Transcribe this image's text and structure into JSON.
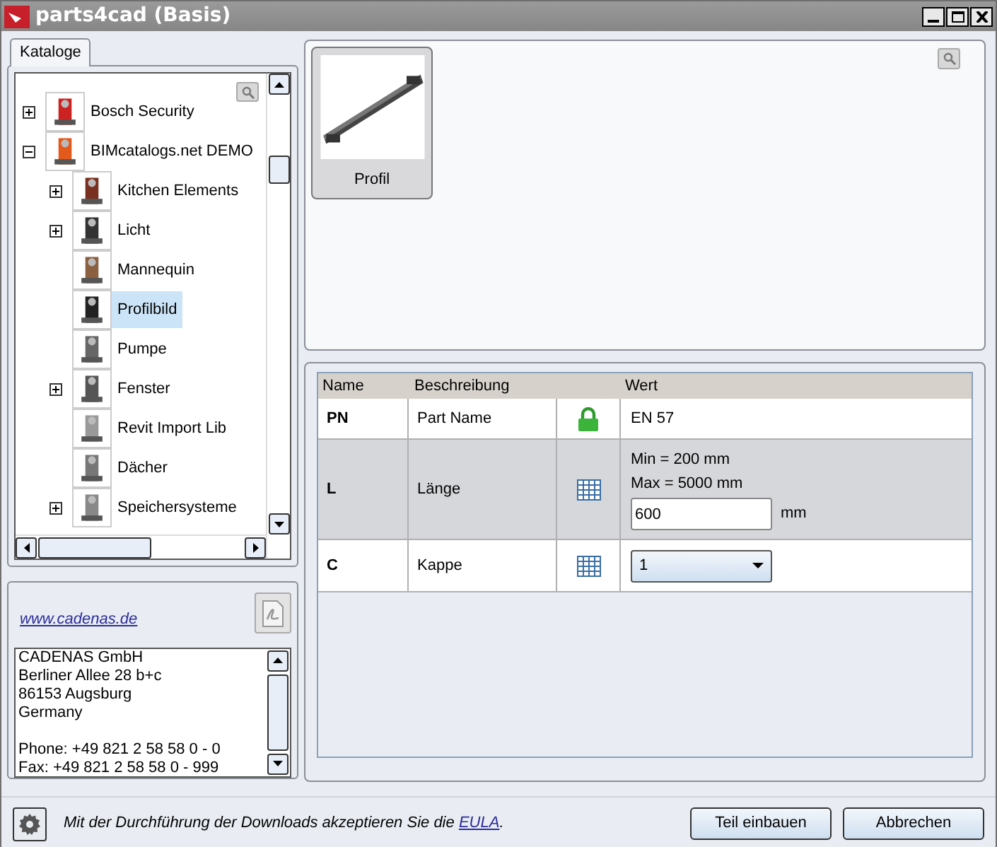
{
  "window": {
    "title": "parts4cad (Basis)"
  },
  "tabs": [
    {
      "label": "Kataloge",
      "selected": true
    }
  ],
  "tree": [
    {
      "label": "Bosch Security",
      "expanded": false,
      "selected": false
    },
    {
      "label": "BIMcatalogs.net DEMO",
      "expanded": true,
      "selected": false,
      "children": [
        {
          "label": "Kitchen Elements",
          "expanded": false,
          "selected": false
        },
        {
          "label": "Licht",
          "expanded": false,
          "selected": false
        },
        {
          "label": "Mannequin",
          "selected": false
        },
        {
          "label": "Profilbild",
          "selected": true
        },
        {
          "label": "Pumpe",
          "selected": false
        },
        {
          "label": "Fenster",
          "expanded": false,
          "selected": false
        },
        {
          "label": "Revit Import Lib",
          "selected": false
        },
        {
          "label": "Dächer",
          "selected": false
        },
        {
          "label": "Speichersysteme",
          "expanded": false,
          "selected": false
        }
      ]
    }
  ],
  "contact": {
    "link": "www.cadenas.de",
    "address": [
      "CADENAS GmbH",
      "Berliner Allee 28 b+c",
      "86153 Augsburg",
      "Germany"
    ],
    "numbers": [
      "Phone: +49 821 2 58 58 0 - 0",
      "Fax: +49 821 2 58 58 0 - 999"
    ]
  },
  "preview": {
    "items": [
      {
        "label": "Profil",
        "selected": true
      }
    ]
  },
  "table": {
    "columns": [
      "Name",
      "Beschreibung",
      "Wert"
    ],
    "rows": [
      {
        "kind": "locked",
        "name": "PN",
        "description": "Part Name",
        "value": "EN 57"
      },
      {
        "kind": "input",
        "name": "L",
        "description": "Länge",
        "min": "Min = 200 mm",
        "max": "Max = 5000 mm",
        "value": "600",
        "unit": "mm"
      },
      {
        "kind": "select",
        "name": "C",
        "description": "Kappe",
        "value": "1"
      }
    ]
  },
  "footer": {
    "notice_before": "Mit der Durchführung der Downloads akzeptieren Sie die",
    "link": "EULA",
    "notice_after": ".",
    "buttons": [
      "Teil einbauen",
      "Abbrechen"
    ]
  }
}
